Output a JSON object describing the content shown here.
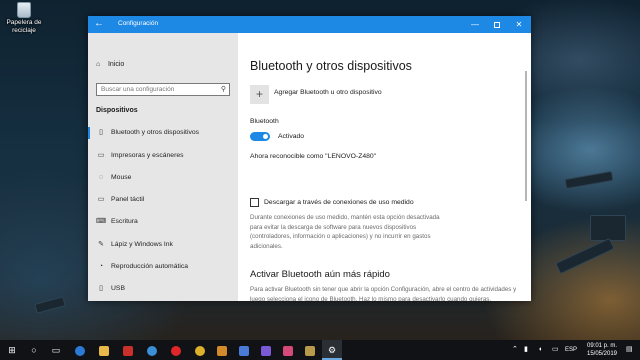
{
  "desktop": {
    "recycle_bin_label": "Papelera de reciclaje"
  },
  "window": {
    "title": "Configuración",
    "back_glyph": "←",
    "minimize_glyph": "—",
    "close_glyph": "✕"
  },
  "sidebar": {
    "home_label": "Inicio",
    "search_placeholder": "Buscar una configuración",
    "section_title": "Dispositivos",
    "items": [
      {
        "label": "Bluetooth y otros dispositivos",
        "icon": "bluetooth-icon",
        "active": true
      },
      {
        "label": "Impresoras y escáneres",
        "icon": "printer-icon",
        "active": false
      },
      {
        "label": "Mouse",
        "icon": "mouse-icon",
        "active": false
      },
      {
        "label": "Panel táctil",
        "icon": "touchpad-icon",
        "active": false
      },
      {
        "label": "Escritura",
        "icon": "keyboard-icon",
        "active": false
      },
      {
        "label": "Lápiz y Windows Ink",
        "icon": "pen-icon",
        "active": false
      },
      {
        "label": "Reproducción automática",
        "icon": "autoplay-icon",
        "active": false
      },
      {
        "label": "USB",
        "icon": "usb-icon",
        "active": false
      }
    ]
  },
  "main": {
    "title": "Bluetooth y otros dispositivos",
    "add_device_label": "Agregar Bluetooth u otro dispositivo",
    "bluetooth_label": "Bluetooth",
    "toggle_state_label": "Activado",
    "toggle_on": true,
    "discoverable_text": "Ahora reconocible como \"LENOVO-Z480\"",
    "metered_checkbox_label": "Descargar a través de conexiones de uso medido",
    "metered_checked": false,
    "metered_description": "Durante conexiones de uso medido, mantén esta opción desactivada para evitar la descarga de software para nuevos dispositivos (controladores, información o aplicaciones) y no incurrir en gastos adicionales.",
    "faster_title": "Activar Bluetooth aún más rápido",
    "faster_description": "Para activar Bluetooth sin tener que abrir la opción Configuración, abre el centro de actividades y luego selecciona el icono de Bluetooth. Haz lo mismo para desactivarlo cuando quieras."
  },
  "taskbar": {
    "language": "ESP",
    "time": "09:01 p. m.",
    "date": "15/05/2019"
  },
  "colors": {
    "accent": "#1e88e5",
    "sidebar_bg": "#e6e6e6",
    "taskbar_bg": "#101215"
  }
}
